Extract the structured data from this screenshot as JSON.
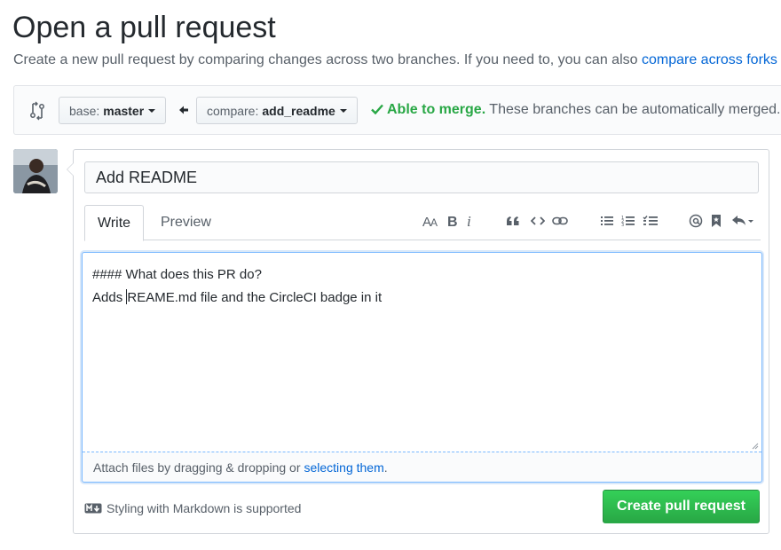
{
  "page": {
    "title": "Open a pull request",
    "subtitle_prefix": "Create a new pull request by comparing changes across two branches. If you need to, you can also ",
    "subtitle_link": "compare across forks"
  },
  "range": {
    "base_prefix": "base:",
    "base_branch": "master",
    "compare_prefix": "compare:",
    "compare_branch": "add_readme",
    "merge_ok": "Able to merge.",
    "merge_text": " These branches can be automatically merged."
  },
  "form": {
    "title_value": "Add README",
    "tabs": [
      {
        "label": "Write",
        "active": true
      },
      {
        "label": "Preview",
        "active": false
      }
    ],
    "toolbar_icons": [
      "header-icon",
      "bold-icon",
      "italic-icon",
      "quote-icon",
      "code-icon",
      "link-icon",
      "bulleted-list-icon",
      "numbered-list-icon",
      "task-list-icon",
      "mention-icon",
      "saved-reply-icon",
      "reply-icon"
    ],
    "body_line1": "#### What does this PR do?",
    "body_line2_before_cursor": "Adds ",
    "body_line2_after_cursor": "REAME.md file and the CircleCI badge in it",
    "attach_prefix": "Attach files by dragging & dropping or ",
    "attach_link": "selecting them",
    "attach_suffix": ".",
    "markdown_note": "Styling with Markdown is supported",
    "submit_label": "Create pull request"
  },
  "colors": {
    "link": "#0366d6",
    "success": "#28a745",
    "focus": "#79b8ff"
  }
}
